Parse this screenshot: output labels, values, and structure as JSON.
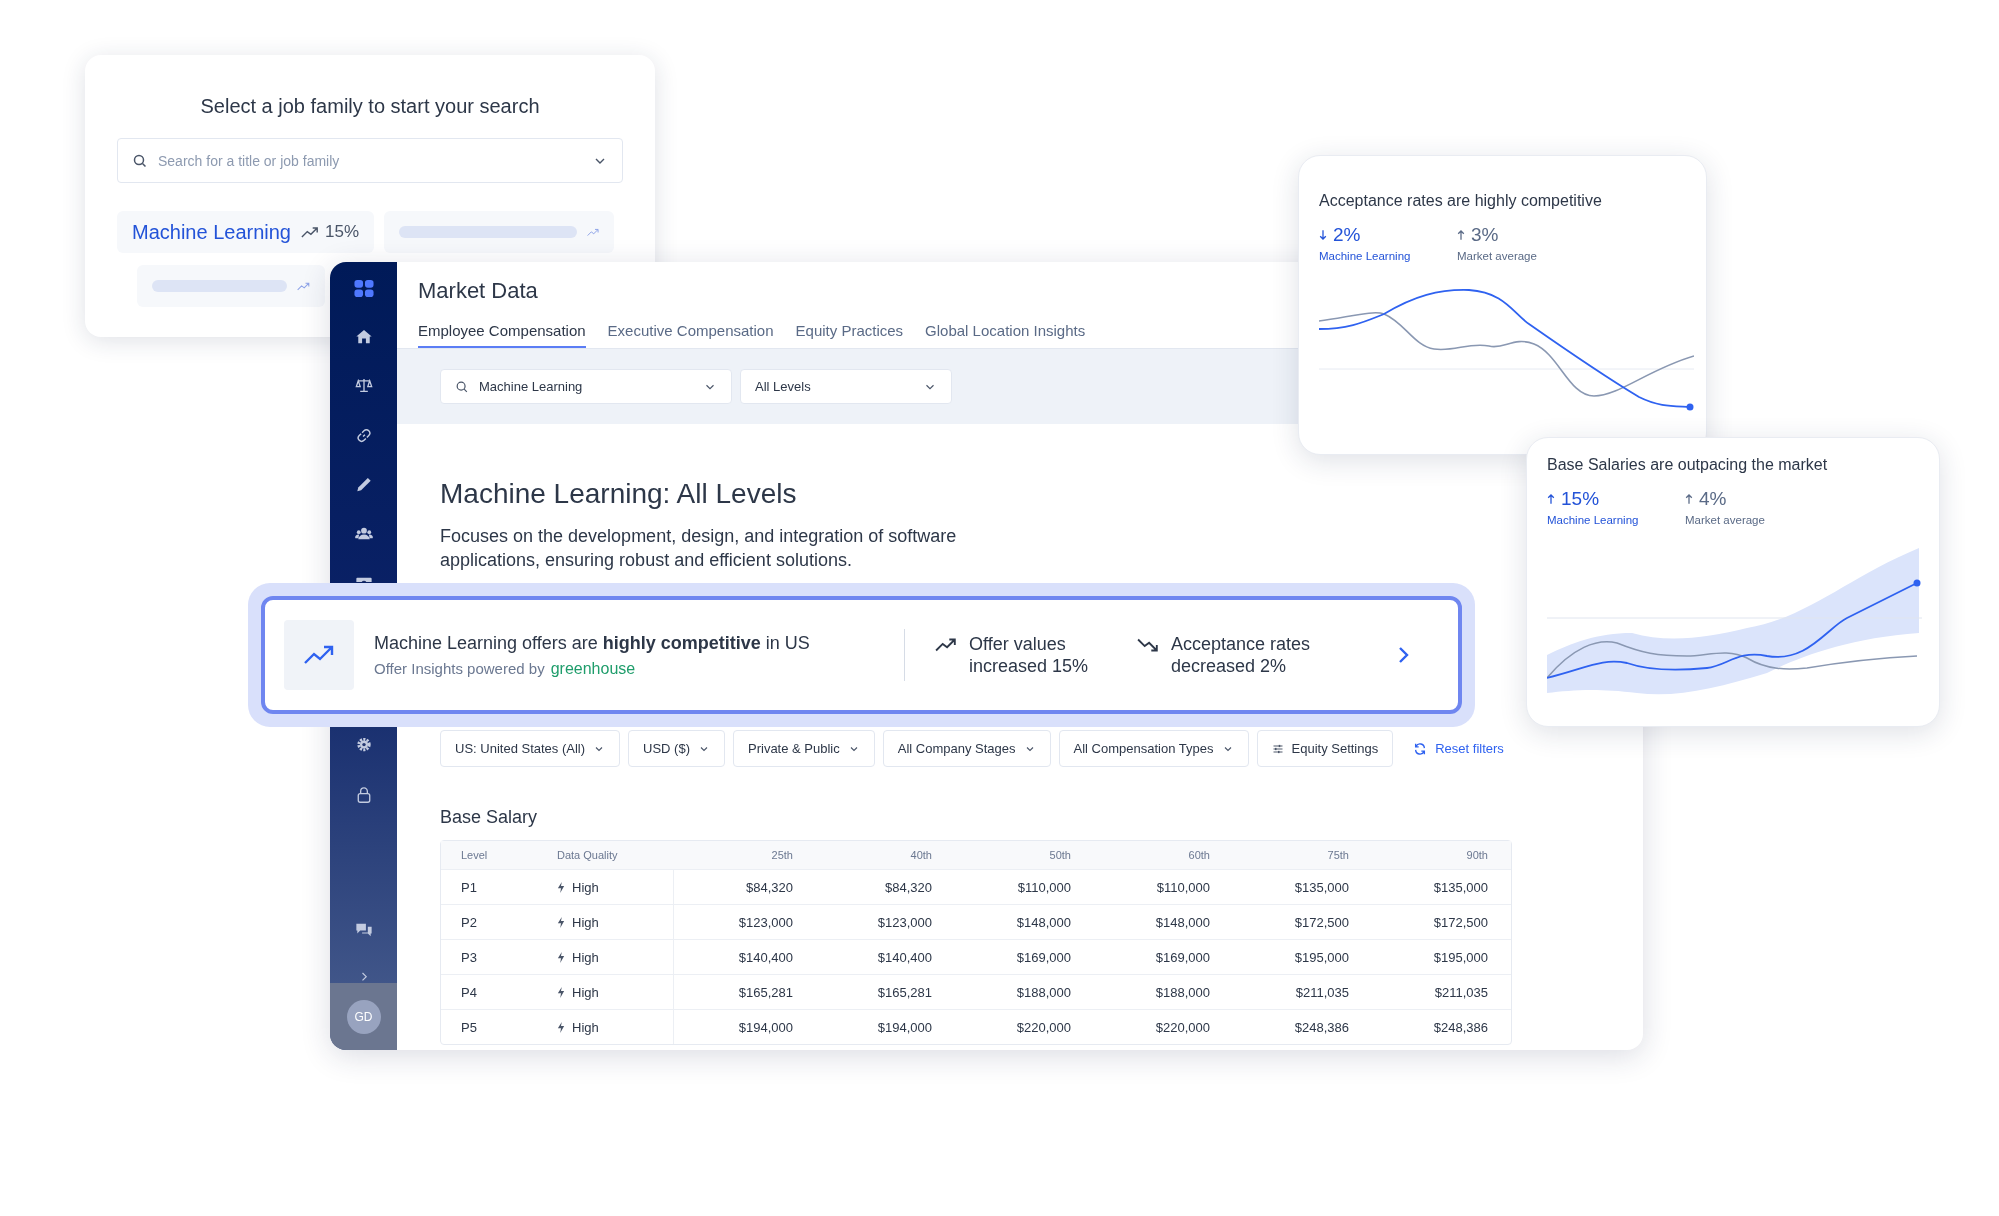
{
  "job_family_card": {
    "title": "Select a job family to start your search",
    "search": {
      "placeholder": "Search for a title or job family"
    },
    "chips": [
      {
        "kind": "job",
        "label": "Machine Learning",
        "change": "15%"
      },
      {
        "kind": "skeleton"
      },
      {
        "kind": "skeleton"
      }
    ]
  },
  "window": {
    "title": "Market Data",
    "avatar": "GD",
    "tabs": [
      {
        "label": "Employee Compensation",
        "selected": true
      },
      {
        "label": "Executive Compensation",
        "selected": false
      },
      {
        "label": "Equity Practices",
        "selected": false
      },
      {
        "label": "Global Location Insights",
        "selected": false
      }
    ],
    "search": {
      "value": "Machine Learning"
    },
    "level_select": {
      "value": "All Levels"
    },
    "heading": "Machine Learning: All Levels",
    "description": "Focuses on the development, design, and integration of software applications, ensuring robust and efficient solutions.",
    "filters": [
      {
        "kind": "dropdown",
        "label": "US: United States (All)"
      },
      {
        "kind": "dropdown",
        "label": "USD ($)"
      },
      {
        "kind": "dropdown",
        "label": "Private & Public"
      },
      {
        "kind": "dropdown",
        "label": "All Company Stages"
      },
      {
        "kind": "dropdown",
        "label": "All Compensation Types"
      },
      {
        "kind": "settings",
        "label": "Equity Settings"
      },
      {
        "kind": "reset",
        "label": "Reset filters"
      }
    ],
    "section_title": "Base Salary",
    "table": {
      "columns": [
        "Level",
        "Data Quality",
        "25th",
        "40th",
        "50th",
        "60th",
        "75th",
        "90th"
      ],
      "rows": [
        [
          "P1",
          "High",
          "$84,320",
          "$84,320",
          "$110,000",
          "$110,000",
          "$135,000",
          "$135,000"
        ],
        [
          "P2",
          "High",
          "$123,000",
          "$123,000",
          "$148,000",
          "$148,000",
          "$172,500",
          "$172,500"
        ],
        [
          "P3",
          "High",
          "$140,400",
          "$140,400",
          "$169,000",
          "$169,000",
          "$195,000",
          "$195,000"
        ],
        [
          "P4",
          "High",
          "$165,281",
          "$165,281",
          "$188,000",
          "$188,000",
          "$211,035",
          "$211,035"
        ],
        [
          "P5",
          "High",
          "$194,000",
          "$194,000",
          "$220,000",
          "$220,000",
          "$248,386",
          "$248,386"
        ]
      ]
    }
  },
  "insight_banner": {
    "headline": "Machine Learning offers are **highly competitive** in US",
    "source": "Offer Insights powered by",
    "brand": "greenhouse",
    "stats": [
      {
        "rising": true,
        "text": "Offer values increased 15%"
      },
      {
        "rising": false,
        "text": "Acceptance rates decreased 2%"
      }
    ]
  },
  "chart_cards": [
    {
      "kind": "acceptance",
      "title": "Acceptance rates are highly competitive",
      "stats": [
        {
          "rising": false,
          "value": "2%",
          "label": "Machine Learning",
          "highlight": true
        },
        {
          "rising": true,
          "value": "3%",
          "label": "Market average",
          "highlight": false
        }
      ]
    },
    {
      "kind": "salary",
      "title": "Base Salaries are outpacing the market",
      "stats": [
        {
          "rising": true,
          "value": "15%",
          "label": "Machine Learning",
          "highlight": true
        },
        {
          "rising": true,
          "value": "4%",
          "label": "Market average",
          "highlight": false
        }
      ]
    }
  ]
}
